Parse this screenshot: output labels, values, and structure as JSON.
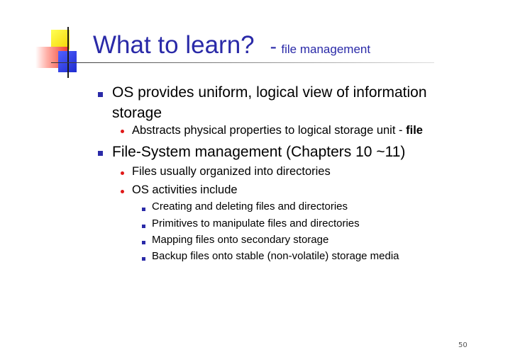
{
  "slide": {
    "title": "What to learn?",
    "title_separator": "-",
    "title_sub": "file management",
    "bullets": {
      "b1": {
        "line1": "OS provides uniform, logical view of information",
        "line2": "storage",
        "sub1": "Abstracts physical properties to logical storage unit  - ",
        "sub1_bold": "file"
      },
      "b2": {
        "text": "File-System management (Chapters 10 ~11)",
        "sub1": "Files usually organized into directories",
        "sub2": "OS activities include",
        "items": [
          "Creating and deleting files and directories",
          "Primitives to manipulate files and directories",
          "Mapping files onto secondary storage",
          "Backup files onto stable (non-volatile) storage media"
        ]
      }
    },
    "page_number": "50"
  }
}
